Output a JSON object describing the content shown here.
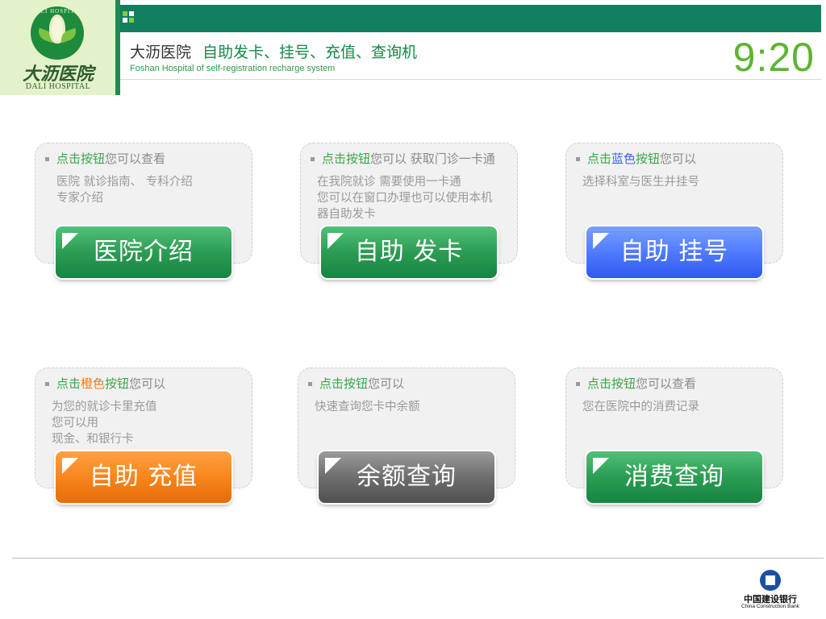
{
  "header": {
    "logo_cn": "大沥医院",
    "logo_en": "DALI HOSPITAL",
    "logo_ring": "DALI HOSPITAL",
    "title_hospital": "大沥医院",
    "title_function": "自助发卡、挂号、充值、查询机",
    "subtitle_en": "Foshan Hospital of self-registration recharge system",
    "time": "9:20"
  },
  "cards": [
    {
      "head_kw": "点击按钮",
      "head_rest": "您可以查看",
      "desc": [
        "医院  就诊指南、 专科介绍",
        "专家介绍"
      ],
      "button": "医院介绍"
    },
    {
      "head_kw": "点击按钮",
      "head_rest": "您可以 获取门诊一卡通",
      "desc": [
        "在我院就诊 需要使用一卡通",
        "您可以在窗口办理也可以使用本机",
        "器自助发卡"
      ],
      "button": "自助 发卡"
    },
    {
      "head_pre": "点击",
      "head_color": "蓝色",
      "head_post": "按钮",
      "head_rest": "您可以",
      "desc": [
        "选择科室与医生并挂号"
      ],
      "button": "自助 挂号"
    },
    {
      "head_pre": "点击",
      "head_color": "橙色",
      "head_post": "按钮",
      "head_rest": "您可以",
      "desc": [
        "为您的就诊卡里充值",
        "您可以用",
        "现金、和银行卡"
      ],
      "button": "自助 充值"
    },
    {
      "head_kw": "点击按钮",
      "head_rest": "您可以",
      "desc": [
        "快速查询您卡中余额"
      ],
      "button": "余额查询"
    },
    {
      "head_kw": "点击按钮",
      "head_rest": "您可以查看",
      "desc": [
        "您在医院中的消费记录"
      ],
      "button": "消费查询"
    }
  ],
  "footer": {
    "bank_cn": "中国建设银行",
    "bank_en": "China Construction Bank"
  },
  "colors": {
    "brand_green": "#128060",
    "button_green": "#2b9d52",
    "button_blue": "#4f7bff",
    "button_orange": "#f7861c",
    "button_gray": "#6e6e6e",
    "clock_green": "#5cb531"
  }
}
